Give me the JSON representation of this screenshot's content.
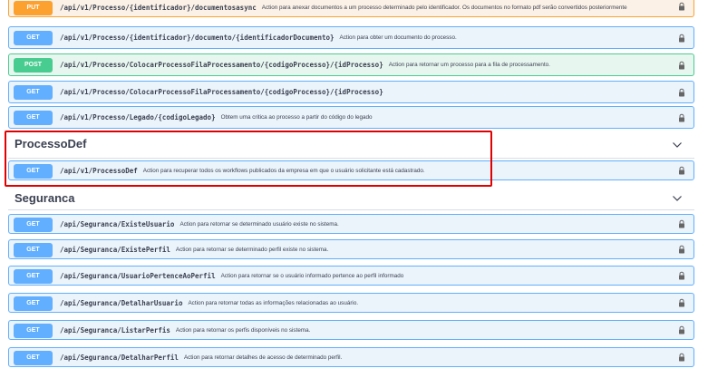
{
  "colors": {
    "get": "#61affe",
    "post": "#49cc90",
    "put": "#fca130",
    "text": "#3b4151",
    "highlight": "#e00000"
  },
  "operations_top": [
    {
      "method": "PUT",
      "path": "/api/v1/Processo/{identificador}/documentosasync",
      "description": "Action para anexar documentos a um processo determinado pelo identificador. Os documentos no formato pdf serão convertidos posteriormente"
    },
    {
      "method": "GET",
      "path": "/api/v1/Processo/{identificador}/documento/{identificadorDocumento}",
      "description": "Action para obter um documento do processo."
    },
    {
      "method": "POST",
      "path": "/api/v1/Processo/ColocarProcessoFilaProcessamento/{codigoProcesso}/{idProcesso}",
      "description": "Action para retornar um processo para a fila de processamento."
    },
    {
      "method": "GET",
      "path": "/api/v1/Processo/ColocarProcessoFilaProcessamento/{codigoProcesso}/{idProcesso}",
      "description": ""
    },
    {
      "method": "GET",
      "path": "/api/v1/Processo/Legado/{codigoLegado}",
      "description": "Obtem uma critica ao processo a partir do código do legado"
    }
  ],
  "section_processodef": {
    "title": "ProcessoDef",
    "operations": [
      {
        "method": "GET",
        "path": "/api/v1/ProcessoDef",
        "description": "Action para recuperar todos os workflows publicados da empresa em que o usuário solicitante está cadastrado."
      }
    ]
  },
  "section_seguranca": {
    "title": "Seguranca",
    "operations": [
      {
        "method": "GET",
        "path": "/api/Seguranca/ExisteUsuario",
        "description": "Action para retornar se determinado usuário existe no sistema."
      },
      {
        "method": "GET",
        "path": "/api/Seguranca/ExistePerfil",
        "description": "Action para retornar se determinado perfil existe no sistema."
      },
      {
        "method": "GET",
        "path": "/api/Seguranca/UsuarioPertenceAoPerfil",
        "description": "Action para retornar se o usuário informado pertence ao perfil informado"
      },
      {
        "method": "GET",
        "path": "/api/Seguranca/DetalharUsuario",
        "description": "Action para retornar todas as informações relacionadas ao usuário."
      },
      {
        "method": "GET",
        "path": "/api/Seguranca/ListarPerfis",
        "description": "Action para retornar os perfis disponíveis no sistema."
      },
      {
        "method": "GET",
        "path": "/api/Seguranca/DetalharPerfil",
        "description": "Action para retornar detalhes de acesso de determinado perfil."
      }
    ]
  },
  "icons": {
    "lock": "lock-icon",
    "chevron": "chevron-down-icon"
  }
}
